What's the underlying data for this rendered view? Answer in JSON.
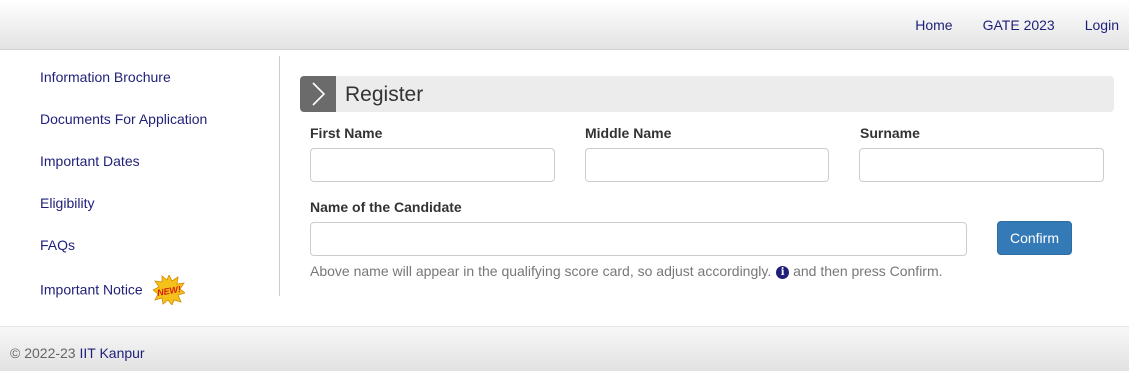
{
  "topnav": {
    "home": "Home",
    "gate": "GATE 2023",
    "login": "Login"
  },
  "sidebar": {
    "items": [
      {
        "label": "Information Brochure"
      },
      {
        "label": "Documents For Application"
      },
      {
        "label": "Important Dates"
      },
      {
        "label": "Eligibility"
      },
      {
        "label": "FAQs"
      },
      {
        "label": "Important Notice",
        "badge": "NEW!"
      }
    ]
  },
  "form": {
    "title": "Register",
    "first_name_label": "First Name",
    "first_name_value": "",
    "middle_name_label": "Middle Name",
    "middle_name_value": "",
    "surname_label": "Surname",
    "surname_value": "",
    "candidate_label": "Name of the Candidate",
    "candidate_value": "",
    "confirm_label": "Confirm",
    "hint_before": "Above name will appear in the qualifying score card, so adjust accordingly.",
    "hint_after": "and then press Confirm."
  },
  "footer": {
    "copyright": "© 2022-23",
    "org": "IIT Kanpur"
  },
  "colors": {
    "link": "#1f1f7a",
    "primary_button": "#337ab7",
    "chevron_box": "#6b6b6b",
    "badge": "#e8a000"
  },
  "icons": {
    "panel": "chevron-right-icon",
    "hint": "info-icon"
  }
}
